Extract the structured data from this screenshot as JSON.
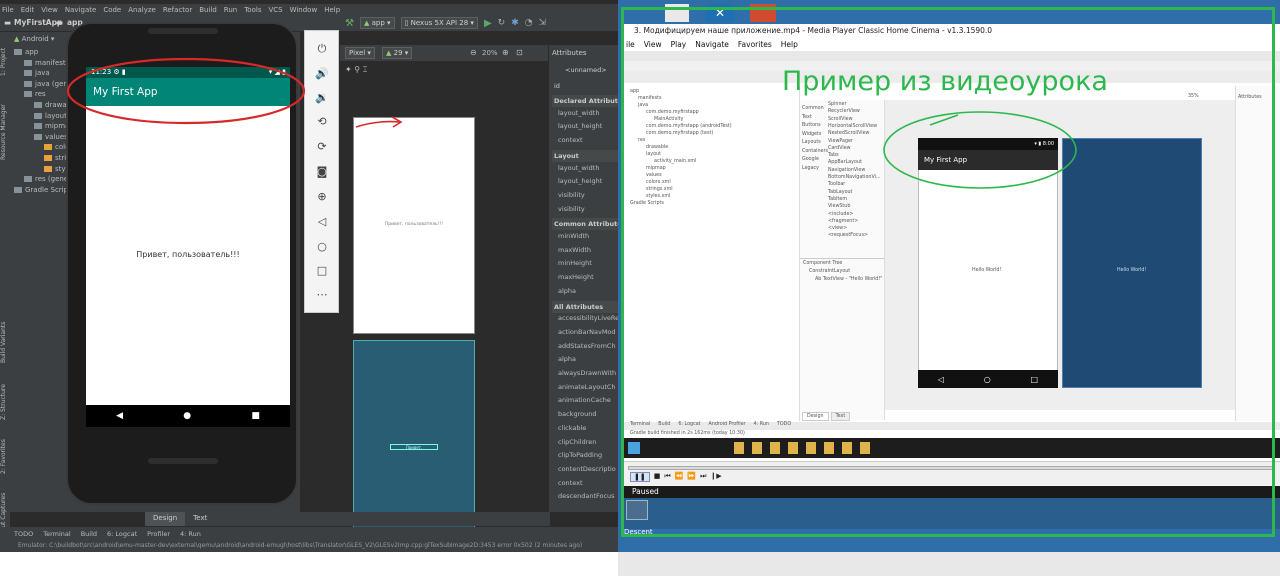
{
  "studio": {
    "menu": [
      "File",
      "Edit",
      "View",
      "Navigate",
      "Code",
      "Analyze",
      "Refactor",
      "Build",
      "Run",
      "Tools",
      "VCS",
      "Window",
      "Help"
    ],
    "breadcrumbs": [
      "MyFirstApp",
      "app"
    ],
    "run_config": "app",
    "device": "Nexus 5X API 28",
    "device_preview": "Pixel",
    "api_level": "29",
    "zoom": "20%",
    "project_view": "Android",
    "tree": [
      {
        "label": "app",
        "indent": 0
      },
      {
        "label": "manifests",
        "indent": 1
      },
      {
        "label": "java",
        "indent": 1
      },
      {
        "label": "java (generated)",
        "indent": 1
      },
      {
        "label": "res",
        "indent": 1
      },
      {
        "label": "drawable",
        "indent": 2
      },
      {
        "label": "layout",
        "indent": 2
      },
      {
        "label": "mipmap",
        "indent": 2
      },
      {
        "label": "values",
        "indent": 2
      },
      {
        "label": "colors",
        "indent": 3
      },
      {
        "label": "strings",
        "indent": 3
      },
      {
        "label": "styles",
        "indent": 3
      },
      {
        "label": "res (generated)",
        "indent": 1
      },
      {
        "label": "Gradle Scripts",
        "indent": 0
      }
    ],
    "side_tabs": [
      "1: Project",
      "Resource Manager",
      "Build Variants",
      "Z: Structure",
      "2: Favorites",
      "Layout Captures"
    ],
    "attributes": {
      "title": "Attributes",
      "unnamed": "<unnamed>",
      "id_label": "id",
      "rows": [
        {
          "text": "Declared Attributes",
          "header": true
        },
        {
          "text": "layout_width",
          "header": false
        },
        {
          "text": "layout_height",
          "header": false
        },
        {
          "text": "context",
          "header": false
        },
        {
          "text": "Layout",
          "header": true
        },
        {
          "text": "layout_width",
          "header": false
        },
        {
          "text": "layout_height",
          "header": false
        },
        {
          "text": "visibility",
          "header": false
        },
        {
          "text": "visibility",
          "header": false
        },
        {
          "text": "Common Attributes",
          "header": true
        },
        {
          "text": "minWidth",
          "header": false
        },
        {
          "text": "maxWidth",
          "header": false
        },
        {
          "text": "minHeight",
          "header": false
        },
        {
          "text": "maxHeight",
          "header": false
        },
        {
          "text": "alpha",
          "header": false
        },
        {
          "text": "All Attributes",
          "header": true
        },
        {
          "text": "accessibilityLiveRe",
          "header": false
        },
        {
          "text": "actionBarNavMod",
          "header": false
        },
        {
          "text": "addStatesFromCh",
          "header": false
        },
        {
          "text": "alpha",
          "header": false
        },
        {
          "text": "alwaysDrawnWith",
          "header": false
        },
        {
          "text": "animateLayoutCh",
          "header": false
        },
        {
          "text": "animationCache",
          "header": false
        },
        {
          "text": "background",
          "header": false
        },
        {
          "text": "clickable",
          "header": false
        },
        {
          "text": "clipChildren",
          "header": false
        },
        {
          "text": "clipToPadding",
          "header": false
        },
        {
          "text": "contentDescriptio",
          "header": false
        },
        {
          "text": "context",
          "header": false
        },
        {
          "text": "descendantFocus",
          "header": false
        }
      ]
    },
    "design_tabs": [
      "Design",
      "Text"
    ],
    "blueprint_text": "Привет, пользователь!!!",
    "bottom_tabs": [
      "TODO",
      "Terminal",
      "Build",
      "6: Logcat",
      "Profiler",
      "4: Run"
    ],
    "status_message": "Emulator: C:\\buildbot\\src\\android\\emu-master-dev\\external\\qemu\\android\\android-emugl\\host\\libs\\Translator\\GLES_V2\\GLESv2Imp.cpp:glTexSubImage2D:3453 error 0x502 (2 minutes ago)"
  },
  "emulator": {
    "time": "11:23",
    "app_title": "My First App",
    "hello_text": "Привет, пользователь!!!",
    "nav": [
      "◀",
      "●",
      "■"
    ]
  },
  "player": {
    "title": "3. Модифицируем наше приложение.mp4 - Media Player Classic Home Cinema - v1.3.1590.0",
    "menu": [
      "ile",
      "View",
      "Play",
      "Navigate",
      "Favorites",
      "Help"
    ],
    "overlay_text": "Пример из видеоурока",
    "status": "Paused",
    "desktop_icon_label": "Descent",
    "video": {
      "app_title": "My First App",
      "hello": "Hello World!",
      "time": "8:00",
      "palette_cats": [
        "Common",
        "Text",
        "Buttons",
        "Widgets",
        "Layouts",
        "Containers",
        "Google",
        "Legacy"
      ],
      "palette_items": [
        "Spinner",
        "RecyclerView",
        "ScrollView",
        "HorizontalScrollView",
        "NestedScrollView",
        "ViewPager",
        "CardView",
        "Tabs",
        "AppBarLayout",
        "NavigationView",
        "BottomNavigationVi...",
        "Toolbar",
        "TabLayout",
        "TabItem",
        "ViewStub",
        "<include>",
        "<fragment>",
        "<view>",
        "<requestFocus>"
      ],
      "tree": [
        "app",
        "manifests",
        "java",
        "com.demo.myfirstapp",
        "MainActivity",
        "com.demo.myfirstapp (androidTest)",
        "com.demo.myfirstapp (test)",
        "res",
        "drawable",
        "layout",
        "activity_main.xml",
        "mipmap",
        "values",
        "colors.xml",
        "strings.xml",
        "styles.xml",
        "Gradle Scripts"
      ],
      "component_tree": [
        "Component Tree",
        "ConstraintLayout",
        "Ab TextView - \"Hello World!\""
      ],
      "tabs": [
        "Design",
        "Text"
      ],
      "bottom": [
        "Terminal",
        "Build",
        "6: Logcat",
        "Android Profiler",
        "4: Run",
        "TODO"
      ],
      "build_msg": "Gradle build finished in 2s 162ms (today 10:30)",
      "attributes": "Attributes",
      "zoom": "35%"
    }
  },
  "colors": {
    "accent_green": "#2db84d",
    "app_teal": "#008577",
    "annotation_red": "#d62a2a"
  }
}
